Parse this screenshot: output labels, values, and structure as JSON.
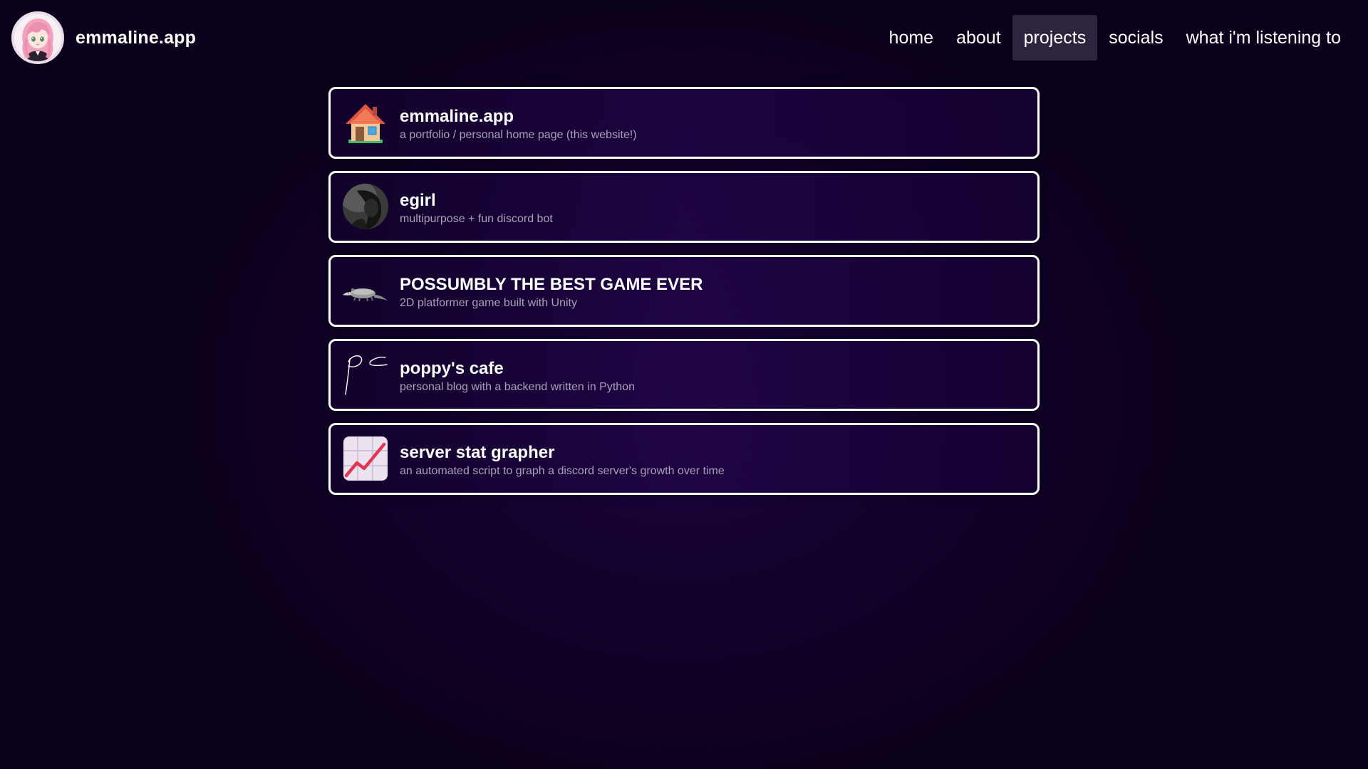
{
  "site": {
    "name": "emmaline.app",
    "avatar_icon": "anime-avatar-icon"
  },
  "nav": {
    "items": [
      {
        "label": "home"
      },
      {
        "label": "about"
      },
      {
        "label": "projects",
        "active": true
      },
      {
        "label": "socials"
      },
      {
        "label": "what i'm listening to"
      }
    ]
  },
  "projects": [
    {
      "title": "emmaline.app",
      "description": "a portfolio / personal home page (this website!)",
      "icon": "house-icon"
    },
    {
      "title": "egirl",
      "description": "multipurpose + fun discord bot",
      "icon": "egirl-avatar-icon"
    },
    {
      "title": "POSSUMBLY THE BEST GAME EVER",
      "description": "2D platformer game built with Unity",
      "icon": "possum-icon"
    },
    {
      "title": "poppy's cafe",
      "description": "personal blog with a backend written in Python",
      "icon": "pc-signature-icon"
    },
    {
      "title": "server stat grapher",
      "description": "an automated script to graph a discord server's growth over time",
      "icon": "chart-increasing-icon"
    }
  ],
  "colors": {
    "background": "#12022b",
    "nav_active_bg": "#2f2440",
    "card_border": "#ffffff",
    "description_text": "#a9a0b8"
  }
}
